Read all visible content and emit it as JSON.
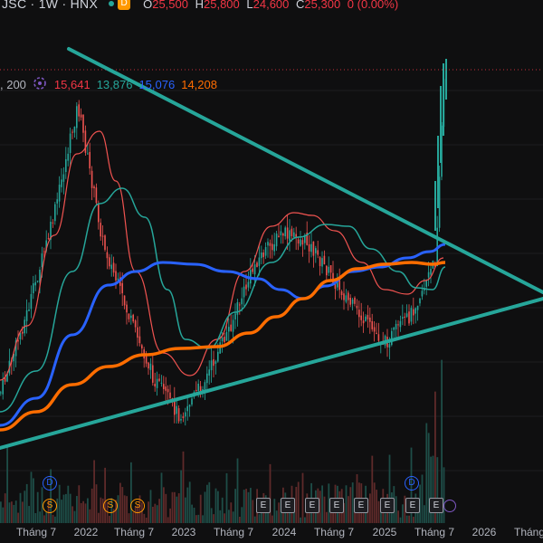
{
  "header": {
    "symbol": "JSC · 1W · HNX",
    "badge": "D",
    "ohlc": [
      {
        "key": "O",
        "value": "25,500"
      },
      {
        "key": "H",
        "value": "25,800"
      },
      {
        "key": "L",
        "value": "24,600"
      },
      {
        "key": "C",
        "value": "25,300"
      }
    ],
    "change": "0 (0.00%)",
    "status_color": "#26a69a",
    "badge_color": "#ff9800"
  },
  "ma_legend": {
    "prefix": ", 200",
    "values": [
      {
        "text": "15,641",
        "color": "#f23645"
      },
      {
        "text": "13,876",
        "color": "#26a69a"
      },
      {
        "text": "15,076",
        "color": "#2962ff"
      },
      {
        "text": "14,208",
        "color": "#ff6d00"
      }
    ]
  },
  "x_axis": {
    "labels": [
      "Tháng 7",
      "2022",
      "Tháng 7",
      "2023",
      "Tháng 7",
      "2024",
      "Tháng 7",
      "2025",
      "Tháng 7",
      "2026",
      "Tháng"
    ]
  },
  "events": {
    "dividend_d": [
      "D",
      "D"
    ],
    "split_s": [
      "S",
      "S",
      "S"
    ],
    "earnings_e": [
      "E",
      "E",
      "E",
      "E",
      "E",
      "E",
      "E",
      "E"
    ]
  },
  "colors": {
    "up": "#26a69a",
    "down": "#ef5350",
    "trendline": "#26a69a",
    "ma_red": "#ef5350",
    "ma_teal": "#26a69a",
    "ma_blue": "#2962ff",
    "ma_orange": "#ff6d00",
    "last_price_line": "#f23645"
  },
  "chart_data": {
    "type": "line",
    "title": "JSC · 1W · HNX",
    "xlabel": "",
    "ylabel": "",
    "series": [
      {
        "name": "",
        "x": [
          "2021-04",
          "2021-07",
          "2021-10",
          "2022-01",
          "2022-04",
          "2022-07",
          "2022-10",
          "2023-01",
          "2023-04",
          "2023-07",
          "2023-10",
          "2024-01",
          "2024-04",
          "2024-07",
          "2024-10",
          "2025-01",
          "2025-04",
          "2025-07",
          "2025-08"
        ],
        "values": [
          7.8,
          12.0,
          17.0,
          23.5,
          16.0,
          12.0,
          8.5,
          6.5,
          8.5,
          11.5,
          15.0,
          16.5,
          16.0,
          14.0,
          12.0,
          10.5,
          12.0,
          15.0,
          25.3
        ]
      }
    ]
  }
}
